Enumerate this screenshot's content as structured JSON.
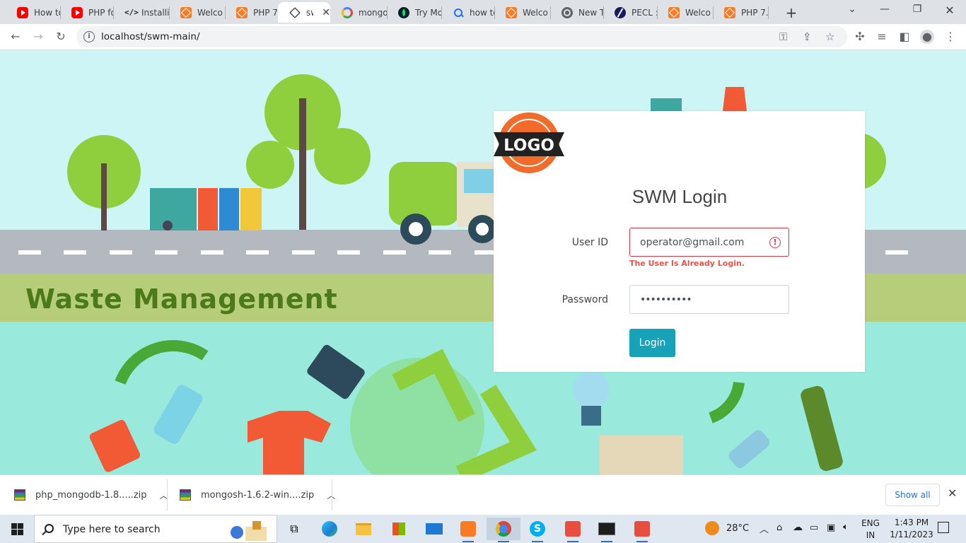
{
  "tabs": [
    {
      "title": "How to",
      "icon": "youtube-icon",
      "kind": "yt"
    },
    {
      "title": "PHP fo",
      "icon": "youtube-icon",
      "kind": "yt"
    },
    {
      "title": "Installi",
      "icon": "code-icon",
      "kind": "code"
    },
    {
      "title": "Welco",
      "icon": "xampp-icon",
      "kind": "xampp"
    },
    {
      "title": "PHP 7.",
      "icon": "xampp-icon",
      "kind": "xampp"
    },
    {
      "title": "swi",
      "icon": "layers-icon",
      "kind": "layers",
      "active": true
    },
    {
      "title": "mongo",
      "icon": "google-icon",
      "kind": "google"
    },
    {
      "title": "Try Mo",
      "icon": "mongodb-icon",
      "kind": "mongo"
    },
    {
      "title": "how to",
      "icon": "search-icon",
      "kind": "search"
    },
    {
      "title": "Welco",
      "icon": "xampp-icon",
      "kind": "xampp"
    },
    {
      "title": "New Ta",
      "icon": "chrome-icon",
      "kind": "chrome"
    },
    {
      "title": "PECL ::",
      "icon": "pecl-icon",
      "kind": "pecl"
    },
    {
      "title": "Welco",
      "icon": "xampp-icon",
      "kind": "xampp"
    },
    {
      "title": "PHP 7.",
      "icon": "xampp-icon",
      "kind": "xampp"
    }
  ],
  "browser": {
    "url": "localhost/swm-main/"
  },
  "banner": {
    "text": "Waste Management"
  },
  "login": {
    "logo_text": "LOGO",
    "title": "SWM Login",
    "user_label": "User ID",
    "user_value": "operator@gmail.com",
    "error": "The User Is Already Login.",
    "password_label": "Password",
    "password_mask": "••••••••••",
    "button": "Login",
    "colors": {
      "button": "#17a2b8",
      "error": "#dc3545",
      "logo": "#f26b2a"
    }
  },
  "downloads": {
    "items": [
      {
        "name": "php_mongodb-1.8.....zip"
      },
      {
        "name": "mongosh-1.6.2-win....zip"
      }
    ],
    "show_all": "Show all"
  },
  "taskbar": {
    "search_placeholder": "Type here to search",
    "temperature": "28°C",
    "lang1": "ENG",
    "lang2": "IN",
    "time": "1:43 PM",
    "date": "1/11/2023"
  }
}
